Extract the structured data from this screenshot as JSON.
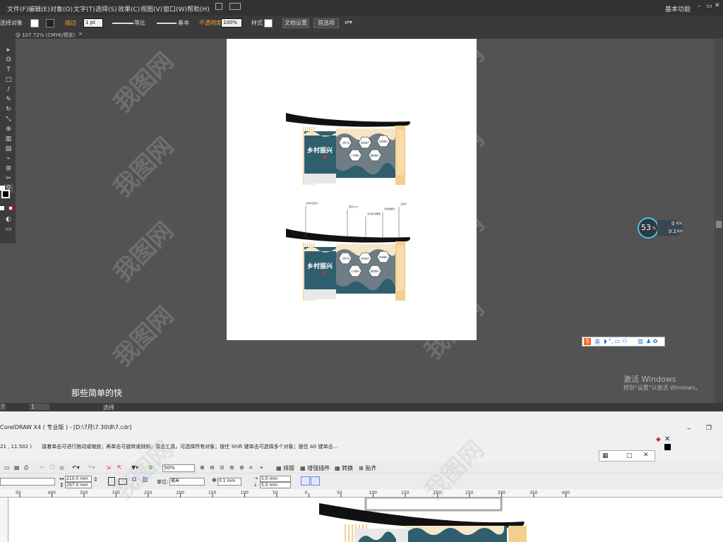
{
  "illustrator": {
    "menu": [
      "文件(F)",
      "编辑(E)",
      "对象(O)",
      "文字(T)",
      "选择(S)",
      "效果(C)",
      "视图(V)",
      "窗口(W)",
      "帮助(H)"
    ],
    "workspace": "基本功能",
    "control_bar": {
      "selection_label": "选择对象",
      "stroke_label": "描边",
      "stroke_value": "1 pt",
      "profile_label": "等比",
      "brush_label": "基本",
      "opacity_label": "不透明度",
      "opacity_value": "100%",
      "style_label": "样式",
      "doc_setup": "文档设置",
      "preferences": "首选项"
    },
    "tab": "@ 107.72% (CMYK/预览)",
    "status_zoom": "?",
    "status_page": "1",
    "status_mode": "选择",
    "subtitle": "那些简单的快",
    "activate_windows": "激活 Windows",
    "activate_hint": "转到\"设置\"以激活 Windows。",
    "speed": {
      "percent": "53",
      "unit": "%",
      "up": "0",
      "up_unit": "K/s",
      "down": "0.1",
      "down_unit": "K/s"
    },
    "ime": [
      "英",
      "简"
    ]
  },
  "artwork": {
    "title": "乡村振兴",
    "hex_labels": [
      "一家产业",
      "文化遗产",
      "生态振兴",
      "人才振兴",
      "组织振兴"
    ],
    "callouts": [
      "立体字亚克力",
      "亚克力UV",
      "文化墙 铝塑板",
      "双色板雕刻",
      "立体字"
    ]
  },
  "coreldraw": {
    "title": "CorelDRAW X4 ( 专业版 ) - [D:\\7月\\7.30\\8\\7.cdr]",
    "hint_coords": "21 , 11.502 )",
    "hint": "接着单击可进行拖动或缩放；再单击可旋转或倾斜；双击工具，可选择所有对象；按住 Shift 键单击可选择多个对象；按住 Alt 键单击...",
    "zoom": "50%",
    "toolbar_buttons": [
      "排版",
      "增强插件",
      "转换",
      "贴齐"
    ],
    "width": "210.0 mm",
    "height": "297.0 mm",
    "units_label": "单位:",
    "units": "毫米",
    "nudge": "0.1 mm",
    "dup_x": "5.0 mm",
    "dup_y": "5.0 mm",
    "ruler_ticks": [
      "50",
      "400",
      "350",
      "300",
      "250",
      "200",
      "150",
      "100",
      "50",
      "0",
      "50",
      "100",
      "150",
      "200",
      "250",
      "300",
      "350",
      "400"
    ]
  },
  "colors": {
    "ai_bg": "#535353",
    "teal": "#2f5f6e",
    "sand": "#f3cf8f",
    "cream": "#f6e6c8",
    "grey": "#6f7d86"
  },
  "watermark": "我图网"
}
